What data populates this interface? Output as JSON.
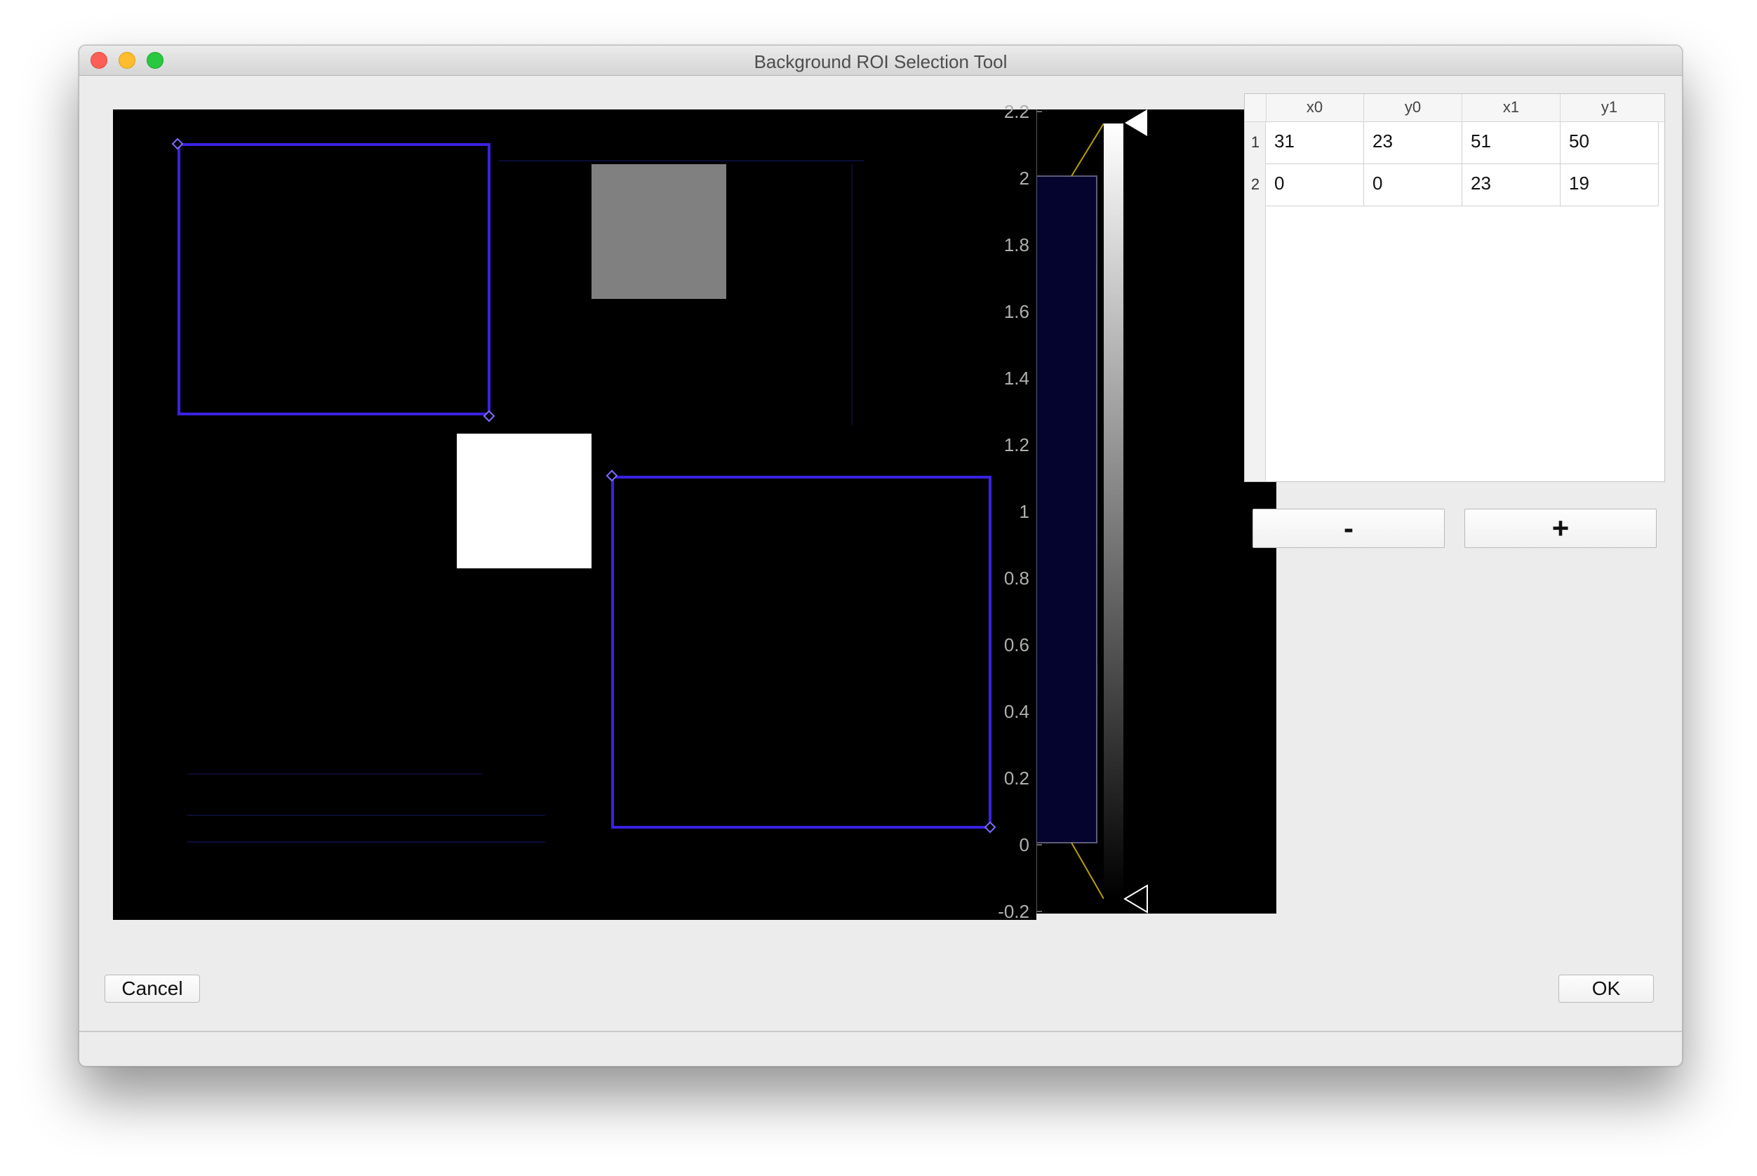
{
  "window": {
    "title": "Background ROI Selection Tool"
  },
  "histogram": {
    "tick_labels": [
      "2.2",
      "2",
      "1.8",
      "1.6",
      "1.4",
      "1.2",
      "1",
      "0.8",
      "0.6",
      "0.4",
      "0.2",
      "0",
      "-0.2"
    ]
  },
  "roi_table": {
    "columns": [
      "x0",
      "y0",
      "x1",
      "y1"
    ],
    "rows": [
      {
        "index": "1",
        "values": [
          "31",
          "23",
          "51",
          "50"
        ]
      },
      {
        "index": "2",
        "values": [
          "0",
          "0",
          "23",
          "19"
        ]
      }
    ]
  },
  "buttons": {
    "remove": "-",
    "add": "+",
    "cancel": "Cancel",
    "ok": "OK"
  },
  "colors": {
    "roi": "#3a22e0",
    "histogram_fill": "#04042e",
    "histogram_outline": "#b8a000"
  }
}
